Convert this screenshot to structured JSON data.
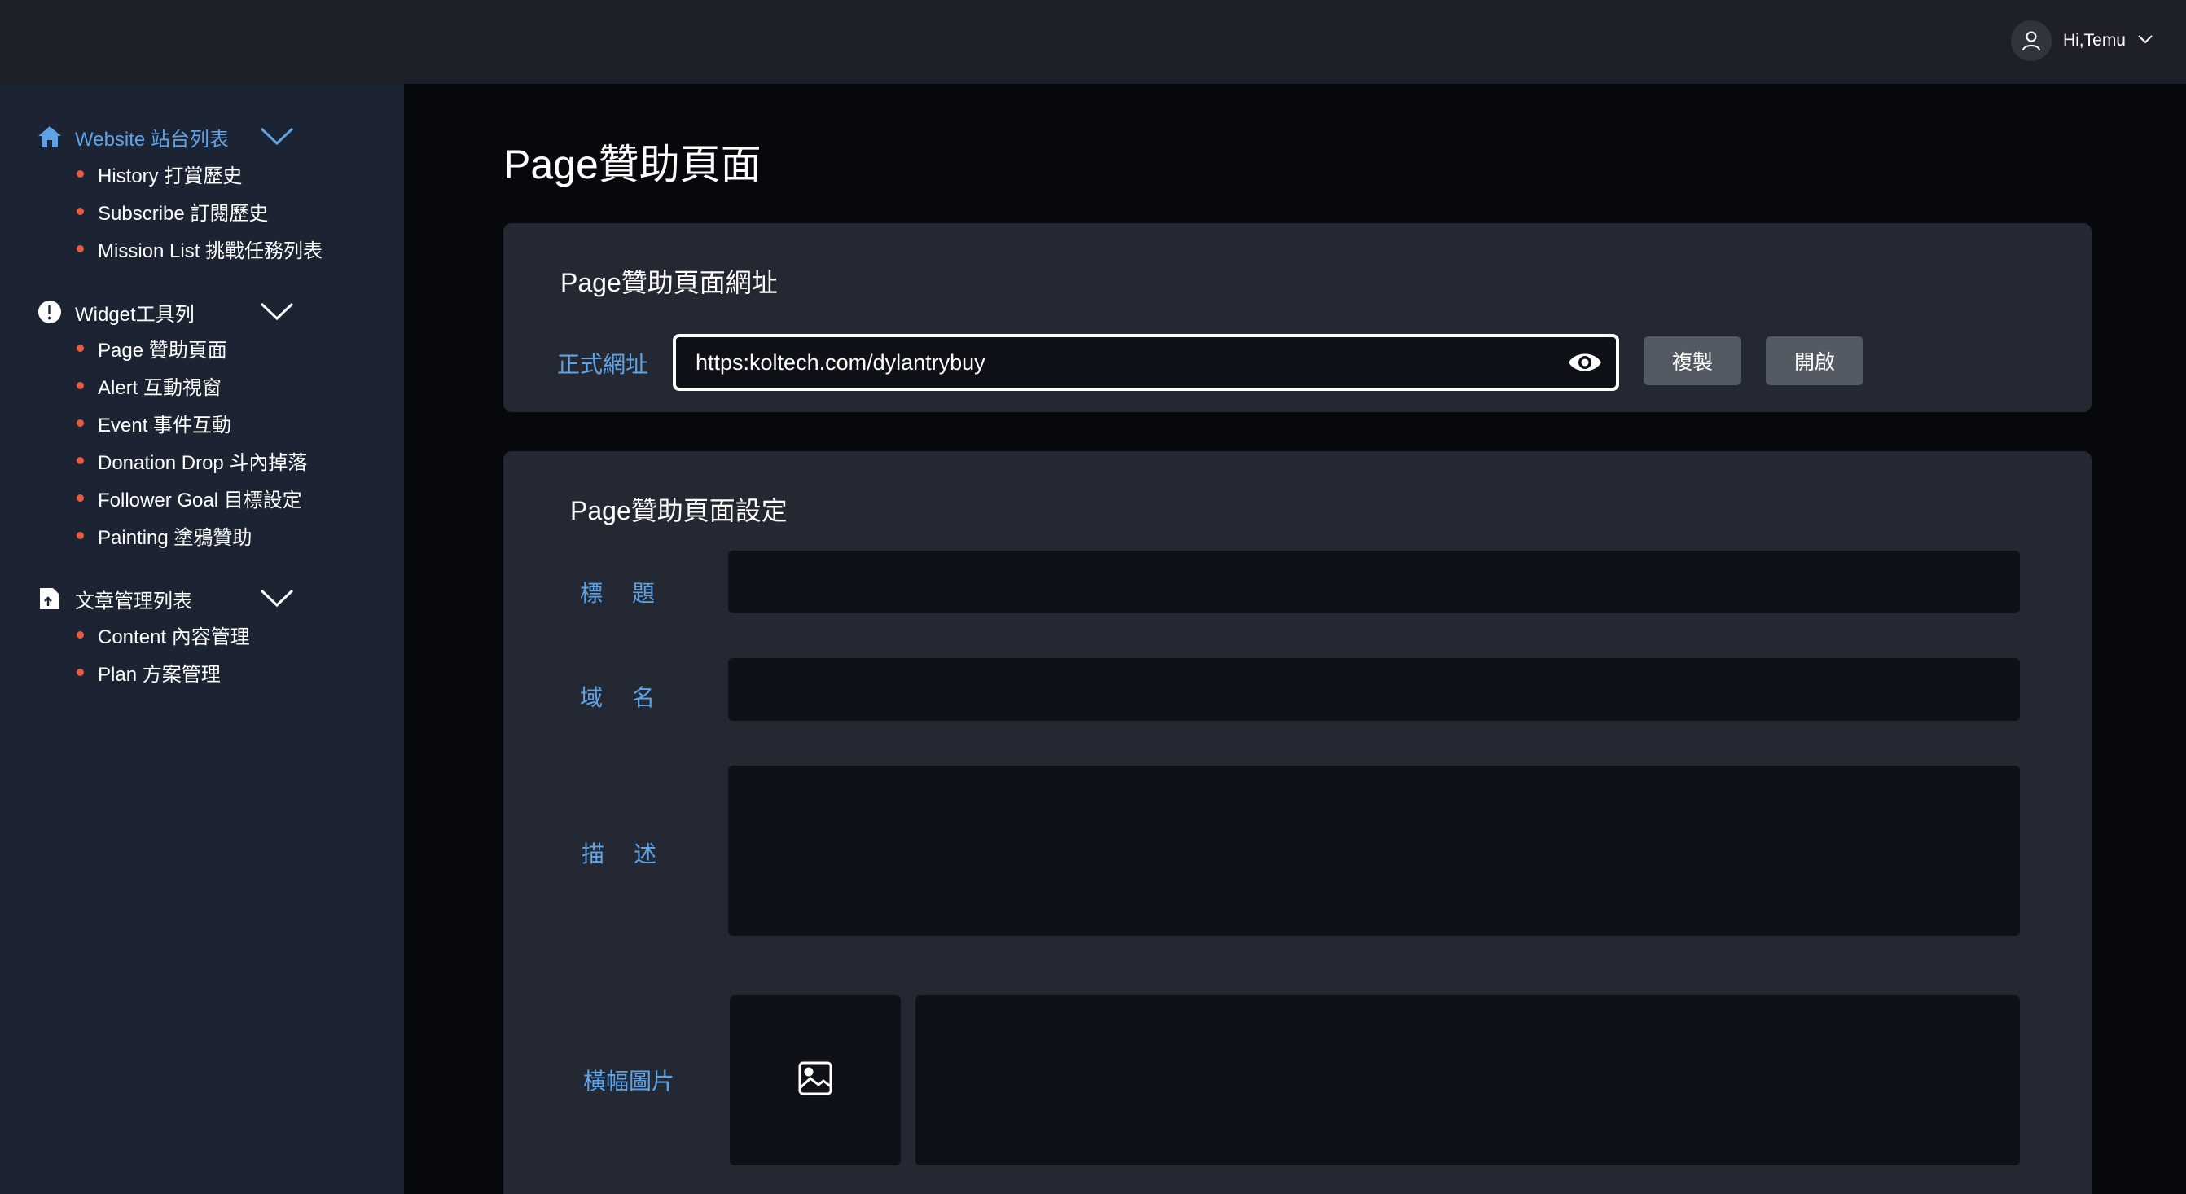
{
  "header": {
    "greeting": "Hi,Temu"
  },
  "sidebar": {
    "groups": [
      {
        "label": "Website 站台列表",
        "icon": "home-icon",
        "active": true,
        "items": [
          {
            "label": "History 打賞歷史"
          },
          {
            "label": "Subscribe 訂閱歷史"
          },
          {
            "label": "Mission List 挑戰任務列表"
          }
        ]
      },
      {
        "label": "Widget工具列",
        "icon": "alert-circle-icon",
        "active": false,
        "items": [
          {
            "label": "Page 贊助頁面"
          },
          {
            "label": "Alert 互動視窗"
          },
          {
            "label": "Event 事件互動"
          },
          {
            "label": "Donation Drop 斗內掉落"
          },
          {
            "label": "Follower Goal 目標設定"
          },
          {
            "label": "Painting 塗鴉贊助"
          }
        ]
      },
      {
        "label": "文章管理列表",
        "icon": "file-upload-icon",
        "active": false,
        "items": [
          {
            "label": "Content 內容管理"
          },
          {
            "label": "Plan 方案管理"
          }
        ]
      }
    ]
  },
  "main": {
    "page_title": "Page贊助頁面",
    "url_card": {
      "title": "Page贊助頁面網址",
      "field_label": "正式網址",
      "url_value": "https:koltech.com/dylantrybuy",
      "copy_button": "複製",
      "open_button": "開啟"
    },
    "settings_card": {
      "title": "Page贊助頁面設定",
      "title_label": "標題",
      "title_value": "",
      "domain_label": "域名",
      "domain_value": "",
      "description_label": "描述",
      "description_value": "",
      "banner_label": "橫幅圖片"
    }
  },
  "colors": {
    "accent": "#5fa3e6",
    "bullet": "#e45c3d",
    "sidebar_bg": "#1c2434",
    "card_bg": "#232833",
    "input_bg": "#0e1118",
    "button_bg": "#545a63"
  }
}
